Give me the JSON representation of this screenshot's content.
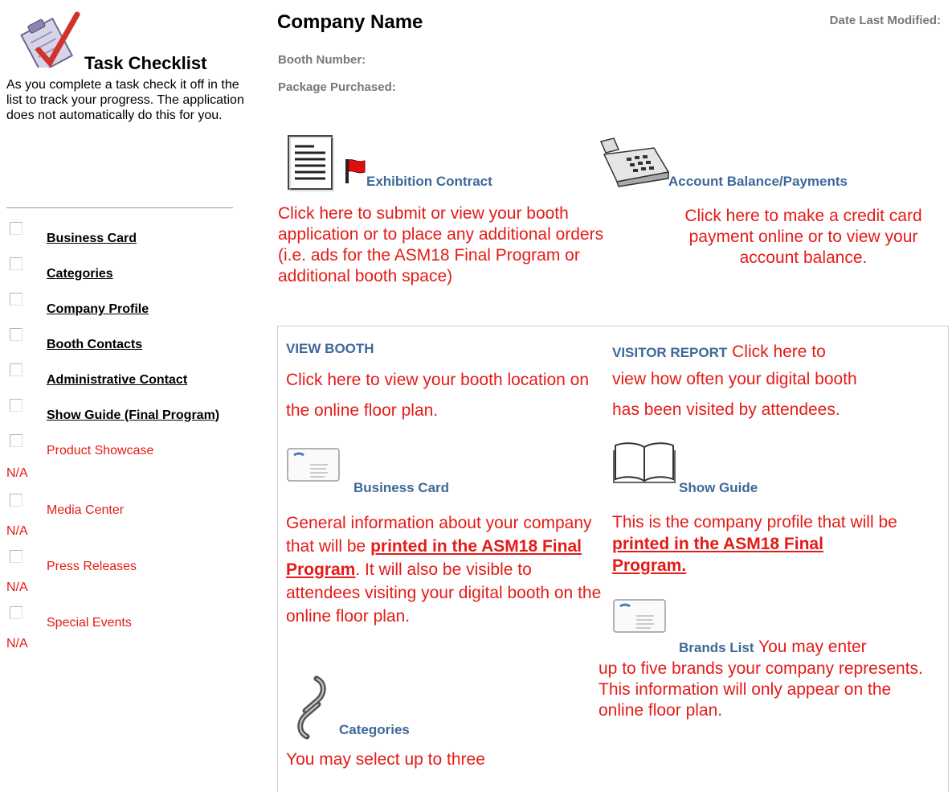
{
  "checklist": {
    "title": "Task Checklist",
    "description": "As you complete a task check it off in the list to track your progress. The application does not automatically do this for you.",
    "tasks": [
      {
        "label": "Business Card"
      },
      {
        "label": "Categories"
      },
      {
        "label": "Company Profile"
      },
      {
        "label": "Booth Contacts"
      },
      {
        "label": "Administrative Contact"
      },
      {
        "label": "Show Guide (Final Program)"
      },
      {
        "label": "Product Showcase",
        "status": "N/A"
      },
      {
        "label": "Media Center",
        "status": "N/A"
      },
      {
        "label": "Press Releases",
        "status": "N/A"
      },
      {
        "label": "Special Events",
        "status": "N/A"
      }
    ]
  },
  "header": {
    "company_name": "Company Name",
    "date_modified_label": "Date Last Modified:",
    "booth_number_label": "Booth Number:",
    "package_label": "Package Purchased:"
  },
  "sections": {
    "contract": {
      "title": "Exhibition Contract",
      "text": "Click here to submit or view your booth application or to place any additional orders (i.e. ads for the ASM18 Final Program or additional booth space)"
    },
    "account": {
      "title": "Account Balance/Payments",
      "text": "Click here to make a credit card payment online or to view your account balance."
    },
    "view_booth": {
      "title": "VIEW BOOTH",
      "text": "Click here to view your booth location on the online floor plan."
    },
    "visitor_report": {
      "title": "VISITOR REPORT",
      "text_line1": "Click here to",
      "text_rest": "view how often your digital booth has been visited by attendees."
    },
    "business_card": {
      "title": "Business Card",
      "text_before": "General information about your company that will be ",
      "text_bold": "printed in the ASM18 Final Program",
      "text_after": ". It will also be visible to attendees visiting your digital booth on the online floor plan."
    },
    "show_guide": {
      "title": "Show Guide",
      "text_before": "This is the company profile that will be ",
      "text_bold": "printed in the ASM18 Final Program."
    },
    "brands": {
      "title": "Brands List",
      "text_line1": "You may enter",
      "text_rest": "up to five brands your company represents. This information will only appear on the online floor plan."
    },
    "categories": {
      "title": "Categories",
      "text": "You may select up to three"
    }
  },
  "icons": {
    "clipboard": "clipboard-check-icon",
    "document": "document-icon",
    "flag": "red-flag-icon",
    "register": "cash-register-icon",
    "card": "business-card-icon",
    "book": "open-book-icon",
    "link": "chain-link-icon"
  },
  "colors": {
    "heading_blue": "#3e6899",
    "alert_red": "#e41b17",
    "meta_gray": "#777777"
  }
}
